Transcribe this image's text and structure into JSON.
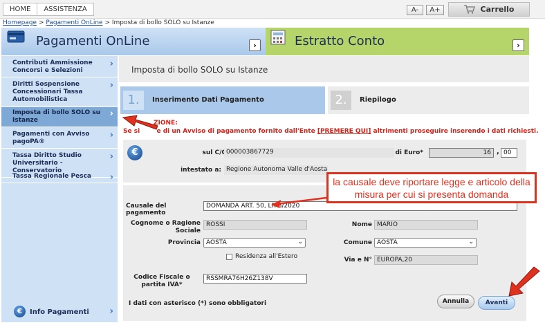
{
  "topnav": {
    "home": "HOME",
    "assistenza": "ASSISTENZA",
    "font_decrease": "A-",
    "font_increase": "A+",
    "cart": "Carrello"
  },
  "breadcrumb": {
    "home": "Homepage",
    "sep": ">",
    "pagamenti": "Pagamenti OnLine",
    "current": "Imposta di bollo SOLO su Istanze"
  },
  "banners": {
    "left_title": "Pagamenti OnLine",
    "right_title": "Estratto Conto"
  },
  "sidebar": {
    "items": [
      {
        "label": "Contributi Ammissione Concorsi e Selezioni"
      },
      {
        "label": "Diritti Sospensione Concessionari Tassa Automobilistica"
      },
      {
        "label": "Imposta di bollo SOLO su Istanze"
      },
      {
        "label": "Pagamenti con Avviso pagoPA®"
      },
      {
        "label": "Tassa Diritto Studio Universitario - Conservatorio"
      },
      {
        "label": "Tassa Regionale Pesca"
      }
    ],
    "info": "Info Pagamenti"
  },
  "main": {
    "title": "Imposta di bollo SOLO su Istanze",
    "steps": [
      {
        "num": "1.",
        "label": "Inserimento Dati Pagamento"
      },
      {
        "num": "2.",
        "label": "Riepilogo"
      }
    ],
    "warning_title": "ZIONE:",
    "warning_prefix": "Se si",
    "warning_mid": "e di un Avviso di pagamento fornito dall'Ente",
    "warning_link": "[PREMERE QUI]",
    "warning_suffix": "altrimenti proseguire inserendo i dati richiesti."
  },
  "form": {
    "cc_label": "sul C/C n.",
    "cc_value": "000003867729",
    "euro_label": "di Euro",
    "euro_int": "16",
    "euro_sep": ",",
    "euro_dec": "00",
    "intestato_label": "intestato a:",
    "intestato_value": "Regione Autonoma Valle d'Aosta",
    "causale_label": "Causale del pagamento",
    "causale_value": "DOMANDA ART. 50, LR 8/2020",
    "cognome_label": "Cognome o Ragione Sociale",
    "cognome_value": "ROSSI",
    "nome_label": "Nome",
    "nome_value": "MARIO",
    "provincia_label": "Provincia",
    "provincia_value": "AOSTA",
    "comune_label": "Comune",
    "comune_value": "AOSTA",
    "residenza_label": "Residenza all'Estero",
    "via_label": "Via e N°",
    "via_value": "EUROPA,20",
    "cf_label": "Codice Fiscale o partita IVA",
    "cf_value": "RSSMRA76H26Z138V",
    "required_asterisk": "*",
    "note": "I dati con asterisco (*) sono obbligatori",
    "annulla": "Annulla",
    "avanti": "Avanti"
  },
  "annotation": {
    "callout": "la causale deve riportare legge e articolo della misura per cui si presenta domanda"
  },
  "colors": {
    "banner_left": "#a9c8ea",
    "banner_right": "#b5d46a",
    "warning": "#d0231a",
    "callout": "#e0301e"
  }
}
